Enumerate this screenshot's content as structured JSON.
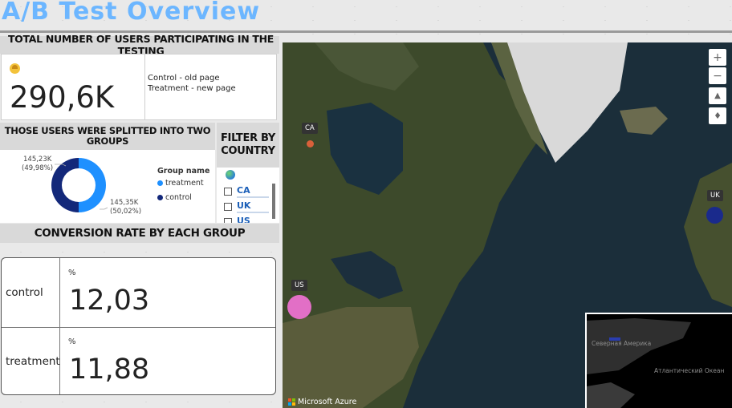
{
  "title": "A/B Test Overview",
  "total": {
    "header": "TOTAL NUMBER OF USERS PARTICIPATING IN THE TESTING",
    "icon": "user-icon",
    "value": "290,6K",
    "legend": [
      "Control - old page",
      "Treatment - new page"
    ]
  },
  "split": {
    "header": "THOSE USERS WERE SPLITTED INTO TWO GROUPS",
    "label_control_value": "145,23K",
    "label_control_pct": "(49,98%)",
    "label_treatment_value": "145,35K",
    "label_treatment_pct": "(50,02%)",
    "legend_title": "Group name",
    "legend": [
      {
        "name": "treatment",
        "color": "#1e90ff"
      },
      {
        "name": "control",
        "color": "#13287a"
      }
    ],
    "shares": {
      "treatment": 50.02,
      "control": 49.98
    }
  },
  "filter": {
    "header": "FILTER BY COUNTRY",
    "icon": "globe-icon",
    "items": [
      "CA",
      "UK",
      "US"
    ]
  },
  "conversion": {
    "header": "CONVERSION RATE BY EACH GROUP",
    "rows": [
      {
        "label": "control",
        "unit": "%",
        "value": "12,03"
      },
      {
        "label": "treatment",
        "unit": "%",
        "value": "11,88"
      }
    ]
  },
  "map": {
    "pins": [
      {
        "label": "CA",
        "color": "#d9603a"
      },
      {
        "label": "UK",
        "color": "#1a2a8c"
      },
      {
        "label": "US",
        "color": "#e26fc6"
      }
    ],
    "attribution": "Microsoft Azure",
    "inset_labels": [
      "Северная Америка",
      "Атлантический Океан"
    ],
    "controls": [
      "zoom-in-icon",
      "zoom-out-icon",
      "tilt-icon",
      "compass-icon"
    ]
  }
}
